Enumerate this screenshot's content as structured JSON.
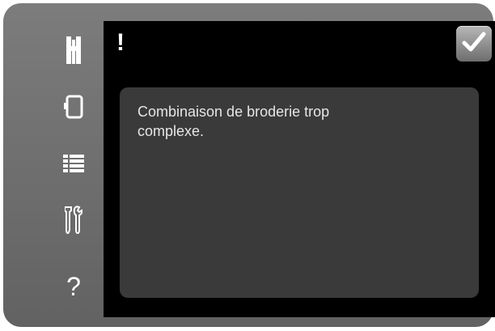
{
  "sidebar": {
    "items": [
      {
        "icon": "presser-foot-icon"
      },
      {
        "icon": "hoop-icon"
      },
      {
        "icon": "list-icon"
      },
      {
        "icon": "tools-icon"
      },
      {
        "icon": "help-icon",
        "label": "?"
      }
    ]
  },
  "dialog": {
    "alert_symbol": "!",
    "confirm_icon": "checkmark-icon",
    "message": "Combinaison de broderie trop complexe."
  },
  "colors": {
    "frame": "#707070",
    "screen": "#000000",
    "message_box": "#3a3a3a",
    "text": "#e6e6e6",
    "icon": "#ffffff"
  }
}
